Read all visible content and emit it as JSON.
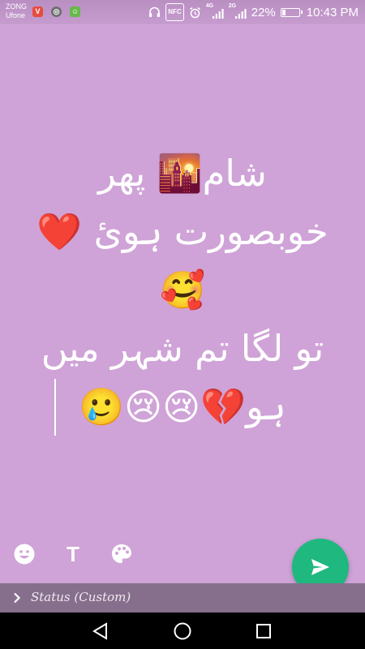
{
  "status_bar": {
    "carrier_1": "ZONG",
    "carrier_2": "Ufone",
    "notif_v": "V",
    "nfc": "NFC",
    "net_1": "4G",
    "net_2": "2G",
    "battery_percent": "22%",
    "battery_level": 0.22,
    "time": "10:43 PM"
  },
  "status_text": {
    "line_1": "شام🌇 پھر",
    "line_2": "خوبصورت ہوئ ❤️",
    "line_3": "🥰",
    "line_4": "تو لگا تم شہر میں",
    "line_5": "ہو💔😢😢🥲"
  },
  "toolbar": {
    "text_tool": "T",
    "icons": [
      "emoji-icon",
      "text-icon",
      "palette-icon",
      "send-icon"
    ]
  },
  "recipient": {
    "label": "Status (Custom)"
  },
  "colors": {
    "background": "#cfa3d7",
    "fab": "#1fb87e",
    "recipient_bar": "#866f8c"
  }
}
